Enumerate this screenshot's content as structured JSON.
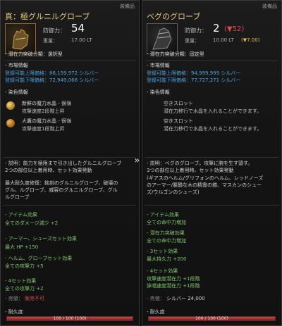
{
  "left": {
    "equipped_label": "装備品",
    "title": "真：極グルニルグローブ",
    "defense_label": "防御力：",
    "defense_value": "54",
    "weight_label": "重量：",
    "weight_value": "17.00 LT",
    "potential_label": "- 潜在力突破分類：選択型",
    "market_head": "- 市場情報",
    "market_max": "登録可能上限価格：86,159,972 シルバー",
    "market_min": "登録可能下限価格：72,949,066 シルバー",
    "dye_head": "- 染色情報",
    "crystals": [
      {
        "name": "新鮮の魔力水晶 - 很嶺",
        "effect": "攻撃速度2段階上昇"
      },
      {
        "name": "大鷹の魔力水晶 - 很嶺",
        "effect": "攻撃速度1段階上昇"
      }
    ],
    "desc_lines": [
      "- 説明：能力を極限まで引き出したグルニルグローブ",
      "  2つの部位以上着用時、セット効果発動",
      "",
      "  最大耐久度修復：銘刻のグルニルグローブ、破壊の",
      "  グル、ルグローブ、威容のグルニルグローブ、グル",
      "  ルグローブ"
    ],
    "item_effect_head": "- アイテム効果",
    "item_effect": "全てのダメージ減少 +2",
    "set1_head": "- アーマー、シューズセット効果",
    "set1_value": "最大 HP +150",
    "set2_head": "- ヘルム、グローブセット効果",
    "set2_value": "全ての攻撃力 +5",
    "set4_head": "- 4セット効果",
    "set4_value": "全ての攻撃力 +2",
    "sale_label": "- 売値：",
    "sale_value": "販売不可",
    "durability_head": "- 耐久度",
    "durability_text": "100 / 100 (100)",
    "durability_ratio": 1.0
  },
  "right": {
    "equipped_label": "装備品",
    "title": "ベグのグローブ",
    "defense_label": "防御力：",
    "defense_value": "2",
    "defense_diff": "(▼52)",
    "weight_label": "重量：",
    "weight_value": "10.00 LT",
    "weight_diff": "(▼7.00)",
    "potential_label": "- 潜在力突破分類：固定型",
    "market_head": "- 市場情報",
    "market_max": "登録可能上限価格：94,999,999 シルバー",
    "market_min": "登録可能下限価格：77,727,271 シルバー",
    "dye_head": "- 染色情報",
    "slots": [
      {
        "name": "空きスロット",
        "effect": "潜在力移行で水晶を入れることができます。"
      },
      {
        "name": "空きスロット",
        "effect": "潜在力移行で水晶を入れることができます。"
      }
    ],
    "desc_lines": [
      "- 説明：ベグのグローブ。攻撃に腕を生す頭す。",
      "  3つの部位以上着用時、セット効果発動",
      "  (ギアスのヘルム/グリフォンのヘルム、レッドノーズ",
      "  のアーマー/悪鶴な木の精霊の鎧、マスカンのシュー",
      "  ズ/ウルゴンのシューズ)"
    ],
    "item_effect_head": "- アイテム効果",
    "item_effect": "全ての命中力増加",
    "potential_head": "- 潜在力突破効果",
    "potential_effect": "全ての命中力増加",
    "set3_head": "- 3セット効果",
    "set3_value": "最大持久力 +200",
    "set4_head": "- 4セット効果",
    "set4_values": [
      "攻撃速度潜在力 +1段階",
      "詠唱速度潜在力 +1段階"
    ],
    "sale_label": "- 売値：",
    "sale_value": "シルバー 24,000",
    "durability_head": "- 耐久度",
    "durability_text": "100 / 100 (100)",
    "durability_ratio": 1.0
  },
  "compare_arrow": "»",
  "colors": {
    "title": "#e6c87a",
    "market_price": "#4aa3e0",
    "durability_bar": "#c84a4a"
  },
  "icons": {
    "left_item": "gauntlet-icon",
    "right_item": "glove-icon",
    "crystal": "crystal-icon"
  }
}
